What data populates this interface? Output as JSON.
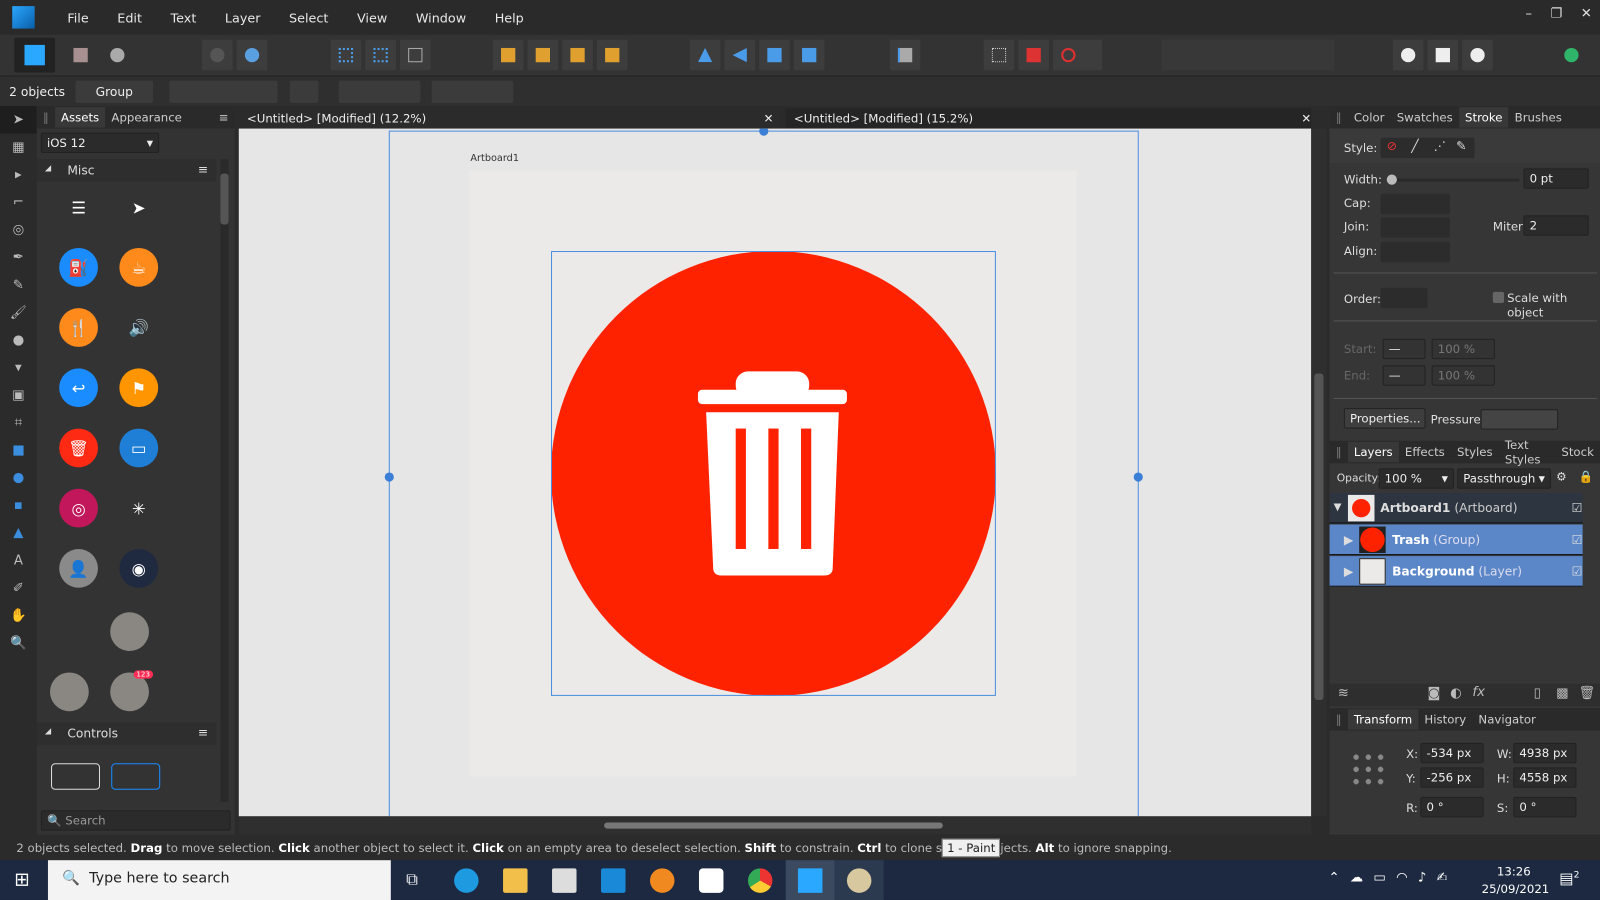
{
  "menu": [
    "File",
    "Edit",
    "Text",
    "Layer",
    "Select",
    "View",
    "Window",
    "Help"
  ],
  "context": {
    "selection_count": "2 objects",
    "group_label": "Group"
  },
  "assets": {
    "tabs": [
      "Assets",
      "Appearance"
    ],
    "set": "iOS 12",
    "category": "Misc",
    "controls": "Controls",
    "search_placeholder": "Search",
    "badge": "123",
    "items": [
      {
        "icon": "list-icon",
        "color": "#333333",
        "glyph": "☰"
      },
      {
        "icon": "location-arrow-icon",
        "color": "#333333",
        "glyph": "➤"
      },
      {
        "icon": "fuel-icon",
        "color": "#1a8cff",
        "glyph": "⛽"
      },
      {
        "icon": "coffee-icon",
        "color": "#ff8a1c",
        "glyph": "☕"
      },
      {
        "icon": "fork-knife-icon",
        "color": "#ff8a1c",
        "glyph": "🍴"
      },
      {
        "icon": "speaker-icon",
        "color": "#333333",
        "glyph": "🔊"
      },
      {
        "icon": "reply-icon",
        "color": "#1a8cff",
        "glyph": "↩"
      },
      {
        "icon": "flag-icon",
        "color": "#ff9500",
        "glyph": "⚑"
      },
      {
        "icon": "trash-icon",
        "color": "#ff2a14",
        "glyph": "🗑"
      },
      {
        "icon": "archive-icon",
        "color": "#1f7fd6",
        "glyph": "▭"
      },
      {
        "icon": "fingerprint-icon",
        "color": "#c2185b",
        "glyph": "◎"
      },
      {
        "icon": "spinner-icon",
        "color": "#333333",
        "glyph": "✳"
      },
      {
        "icon": "avatar-icon",
        "color": "#8a8a8a",
        "glyph": "👤"
      },
      {
        "icon": "radio-icon",
        "color": "#1f2a40",
        "glyph": "◉"
      }
    ]
  },
  "tabs": [
    {
      "label": "<Untitled> [Modified] (12.2%)"
    },
    {
      "label": "<Untitled> [Modified] (15.2%)"
    }
  ],
  "canvas": {
    "artboard_name": "Artboard1",
    "circle_color": "#ff2200",
    "artboard_color": "#ebeae8"
  },
  "stroke_panel": {
    "tabs": [
      "Color",
      "Swatches",
      "Stroke",
      "Brushes"
    ],
    "style_label": "Style:",
    "width_label": "Width:",
    "width_value": "0 pt",
    "cap_label": "Cap:",
    "join_label": "Join:",
    "miter_label": "Miter:",
    "miter_value": "2",
    "align_label": "Align:",
    "order_label": "Order:",
    "scale_label": "Scale with object",
    "start_label": "Start:",
    "end_label": "End:",
    "start_pct": "100 %",
    "end_pct": "100 %",
    "properties": "Properties...",
    "pressure": "Pressure:"
  },
  "layers_panel": {
    "tabs": [
      "Layers",
      "Effects",
      "Styles",
      "Text Styles",
      "Stock"
    ],
    "opacity_label": "Opacity:",
    "opacity": "100 %",
    "blend": "Passthrough",
    "layers": [
      {
        "name": "Artboard1",
        "type": "(Artboard)"
      },
      {
        "name": "Trash",
        "type": "(Group)"
      },
      {
        "name": "Background",
        "type": "(Layer)"
      }
    ]
  },
  "transform_panel": {
    "tabs": [
      "Transform",
      "History",
      "Navigator"
    ],
    "x": "-534 px",
    "y": "-256 px",
    "w": "4938 px",
    "h": "4558 px",
    "r": "0 °",
    "s": "0 °"
  },
  "status": {
    "p1": "2 objects selected. ",
    "b1": "Drag",
    "p2": " to move selection. ",
    "b2": "Click",
    "p3": " another object to select it. ",
    "b3": "Click",
    "p4": " on an empty area to deselect selection. ",
    "b4": "Shift",
    "p5": " to constrain. ",
    "b5": "Ctrl",
    "p6": " to clone s",
    "tooltip": "1 - Paint",
    "p7": "jects. ",
    "b6": "Alt",
    "p8": " to ignore snapping."
  },
  "taskbar": {
    "search_placeholder": "Type here to search",
    "time": "13:26",
    "date": "25/09/2021",
    "notifications": "2"
  }
}
